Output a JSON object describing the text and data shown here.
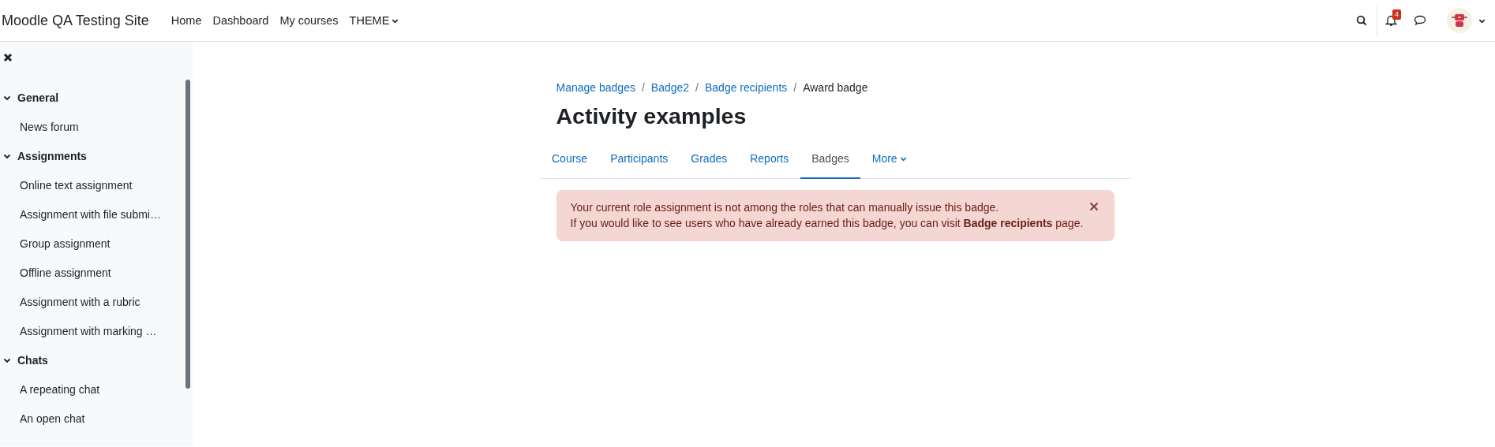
{
  "navbar": {
    "site_name": "Moodle QA Testing Site",
    "links": [
      {
        "label": "Home",
        "has_menu": false
      },
      {
        "label": "Dashboard",
        "has_menu": false
      },
      {
        "label": "My courses",
        "has_menu": false
      },
      {
        "label": "THEME",
        "has_menu": true
      }
    ],
    "notification_count": "4"
  },
  "sidebar": {
    "sections": [
      {
        "title": "General",
        "expanded": true,
        "children": [
          {
            "label": "News forum"
          }
        ]
      },
      {
        "title": "Assignments",
        "expanded": true,
        "children": [
          {
            "label": "Online text assignment"
          },
          {
            "label": "Assignment with file submi…"
          },
          {
            "label": "Group assignment"
          },
          {
            "label": "Offline assignment"
          },
          {
            "label": "Assignment with a rubric"
          },
          {
            "label": "Assignment with marking …"
          }
        ]
      },
      {
        "title": "Chats",
        "expanded": true,
        "children": [
          {
            "label": "A repeating chat"
          },
          {
            "label": "An open chat"
          }
        ]
      }
    ]
  },
  "breadcrumb": [
    {
      "label": "Manage badges",
      "link": true
    },
    {
      "separator": "/",
      "label": "Badge2",
      "link": true
    },
    {
      "separator": "/",
      "label": "Badge recipients",
      "link": true
    },
    {
      "separator": "/",
      "label": "Award badge",
      "link": false
    }
  ],
  "page_title": "Activity examples",
  "tabs": [
    {
      "label": "Course",
      "selected": false,
      "has_menu": false
    },
    {
      "label": "Participants",
      "selected": false,
      "has_menu": false
    },
    {
      "label": "Grades",
      "selected": false,
      "has_menu": false
    },
    {
      "label": "Reports",
      "selected": false,
      "has_menu": false
    },
    {
      "label": "Badges",
      "selected": true,
      "has_menu": false
    },
    {
      "label": "More",
      "selected": false,
      "has_menu": true
    }
  ],
  "alert": {
    "lines": [
      "Your current role assignment is not among the roles that can manually issue this badge.",
      "If you would like to see users who have already earned this badge, you can visit **Badge recipients** page."
    ]
  }
}
